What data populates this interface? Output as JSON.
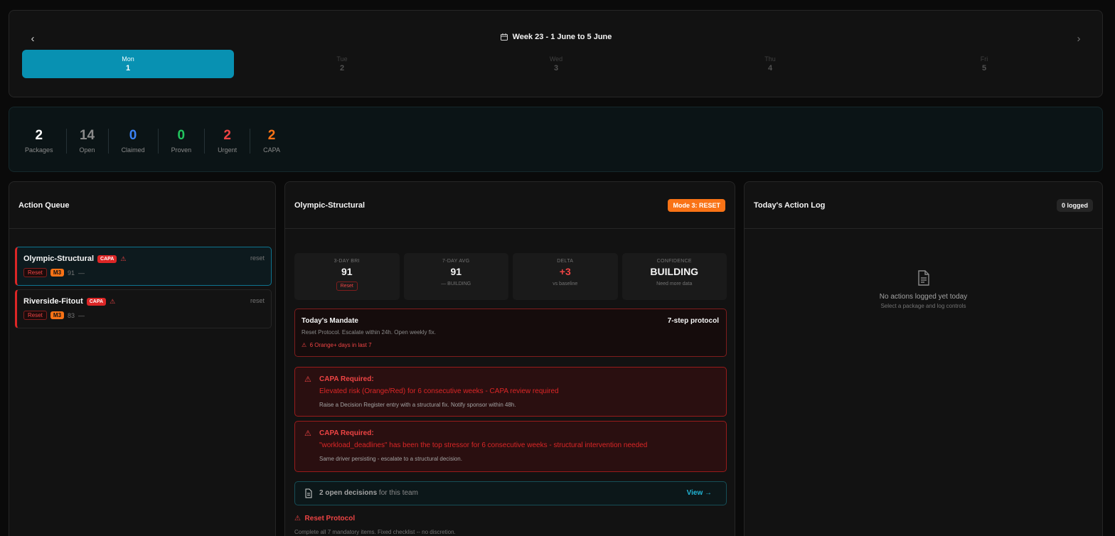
{
  "week": {
    "title": "Week 23 - 1 June to 5 June",
    "prev_icon": "chevron-left-icon",
    "next_icon": "chevron-right-icon",
    "days": [
      {
        "name": "Mon",
        "num": "1",
        "active": true
      },
      {
        "name": "Tue",
        "num": "2",
        "active": false
      },
      {
        "name": "Wed",
        "num": "3",
        "active": false
      },
      {
        "name": "Thu",
        "num": "4",
        "active": false
      },
      {
        "name": "Fri",
        "num": "5",
        "active": false
      }
    ]
  },
  "stats": [
    {
      "value": "2",
      "label": "Packages",
      "color": "#ffffff"
    },
    {
      "value": "14",
      "label": "Open",
      "color": "#8a8a8a"
    },
    {
      "value": "0",
      "label": "Claimed",
      "color": "#3b82f6"
    },
    {
      "value": "0",
      "label": "Proven",
      "color": "#22c55e"
    },
    {
      "value": "2",
      "label": "Urgent",
      "color": "#ef4444"
    },
    {
      "value": "2",
      "label": "CAPA",
      "color": "#f97316"
    }
  ],
  "queue": {
    "title": "Action Queue",
    "items": [
      {
        "name": "Olympic-Structural",
        "badge": "CAPA",
        "action": "reset",
        "status": "Reset",
        "mode": "M3",
        "score": "91",
        "dash": "—"
      },
      {
        "name": "Riverside-Fitout",
        "badge": "CAPA",
        "action": "reset",
        "status": "Reset",
        "mode": "M3",
        "score": "83",
        "dash": "—"
      }
    ]
  },
  "detail": {
    "title": "Olympic-Structural",
    "mode_badge": "Mode 3: RESET",
    "metrics": {
      "bri": {
        "label": "3-DAY BRI",
        "value": "91",
        "tag": "Reset"
      },
      "avg": {
        "label": "7-DAY AVG",
        "value": "91",
        "sub": "—  BUILDING"
      },
      "delta": {
        "label": "DELTA",
        "value": "+3",
        "sub": "vs baseline"
      },
      "confidence": {
        "label": "CONFIDENCE",
        "value": "BUILDING",
        "sub": "Need more data"
      }
    },
    "mandate": {
      "title": "Today's Mandate",
      "protocol": "7-step protocol",
      "desc": "Reset Protocol. Escalate within 24h. Open weekly fix.",
      "warning": "6 Orange+ days in last 7"
    },
    "capa": [
      {
        "title": "CAPA Required:",
        "message": "Elevated risk (Orange/Red) for 6 consecutive weeks - CAPA review required",
        "sub": "Raise a Decision Register entry with a structural fix. Notify sponsor within 48h."
      },
      {
        "title": "CAPA Required:",
        "message": "\"workload_deadlines\" has been the top stressor for 6 consecutive weeks - structural intervention needed",
        "sub": "Same driver persisting - escalate to a structural decision."
      }
    ],
    "decisions": {
      "count_text": "2 open decisions",
      "suffix": " for this team",
      "view": "View →"
    },
    "reset_protocol": {
      "title": "Reset Protocol",
      "sub": "Complete all 7 mandatory items. Fixed checklist -- no discretion."
    }
  },
  "log": {
    "title": "Today's Action Log",
    "badge": "0 logged",
    "empty_title": "No actions logged yet today",
    "empty_sub": "Select a package and log controls"
  }
}
